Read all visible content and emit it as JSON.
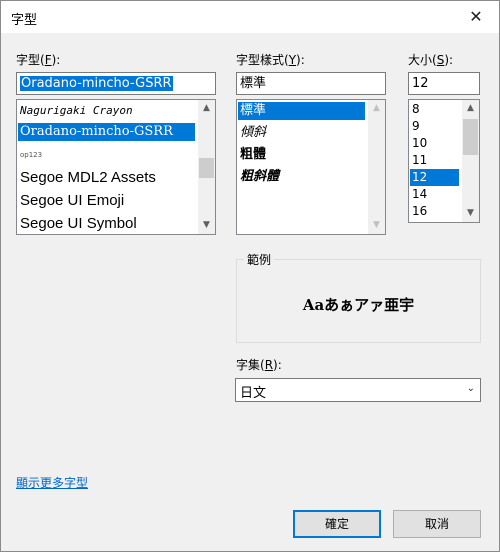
{
  "window": {
    "title": "字型",
    "close_glyph": "✕"
  },
  "font": {
    "label": "字型(",
    "label_key": "F",
    "label_end": "):",
    "value": "Oradano-mincho-GSRR",
    "items": [
      "Nagurigaki Crayon",
      "Oradano-mincho-GSRR",
      "op123",
      "Segoe MDL2 Assets",
      "Segoe UI Emoji",
      "Segoe UI Symbol"
    ],
    "selected_index": 1,
    "scroll_fraction": 0.7
  },
  "style": {
    "label": "字型樣式(",
    "label_key": "Y",
    "label_end": "):",
    "value": "標準",
    "items": [
      "標準",
      "傾斜",
      "粗體",
      "粗斜體"
    ],
    "selected_index": 0
  },
  "size": {
    "label": "大小(",
    "label_key": "S",
    "label_end": "):",
    "value": "12",
    "items": [
      "8",
      "9",
      "10",
      "11",
      "12",
      "14",
      "16"
    ],
    "selected_index": 4
  },
  "sample": {
    "title": "範例",
    "text": "Aaあぁアァ亜宇"
  },
  "script": {
    "label": "字集(",
    "label_key": "R",
    "label_end": "):",
    "value": "日文"
  },
  "more_fonts_link": "顯示更多字型",
  "buttons": {
    "ok": "確定",
    "cancel": "取消"
  },
  "colors": {
    "selection": "#0078d7",
    "link": "#0066cc"
  },
  "icons": {
    "scroll_up": "▲",
    "scroll_down": "▼",
    "dropdown": "⌄"
  }
}
